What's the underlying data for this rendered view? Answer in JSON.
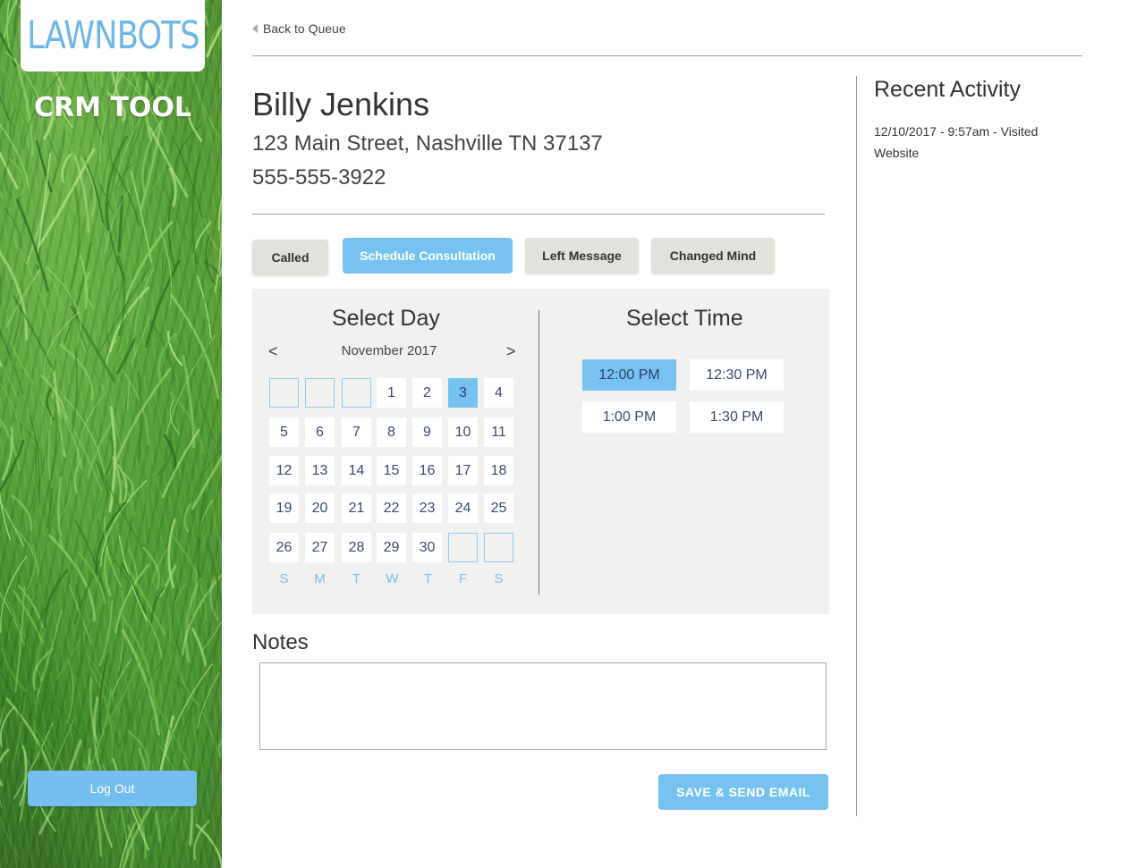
{
  "sidebar": {
    "logo": "LAWNBOTS",
    "subtitle": "CRM TOOL",
    "logout_label": "Log Out"
  },
  "nav": {
    "back_label": "Back to Queue"
  },
  "customer": {
    "name": "Billy Jenkins",
    "address": "123 Main Street, Nashville TN 37137",
    "phone": "555-555-3922"
  },
  "actions": [
    {
      "label": "Called",
      "active": false
    },
    {
      "label": "Schedule Consultation",
      "active": true
    },
    {
      "label": "Left Message",
      "active": false
    },
    {
      "label": "Changed Mind",
      "active": false
    }
  ],
  "calendar": {
    "title": "Select Day",
    "month_label": "November 2017",
    "prev_glyph": "<",
    "next_glyph": ">",
    "days": [
      "",
      "",
      "",
      "1",
      "2",
      "3",
      "4",
      "5",
      "6",
      "7",
      "8",
      "9",
      "10",
      "11",
      "12",
      "13",
      "14",
      "15",
      "16",
      "17",
      "18",
      "19",
      "20",
      "21",
      "22",
      "23",
      "24",
      "25",
      "26",
      "27",
      "28",
      "29",
      "30",
      "",
      ""
    ],
    "selected_day": "3",
    "weekdays": [
      "S",
      "M",
      "T",
      "W",
      "T",
      "F",
      "S"
    ]
  },
  "time": {
    "title": "Select Time",
    "slots": [
      "12:00 PM",
      "12:30 PM",
      "1:00 PM",
      "1:30 PM"
    ],
    "selected": "12:00 PM"
  },
  "notes": {
    "label": "Notes",
    "value": ""
  },
  "save_label": "SAVE & SEND EMAIL",
  "recent": {
    "title": "Recent Activity",
    "items": [
      "12/10/2017 - 9:57am - Visited Website"
    ]
  },
  "colors": {
    "accent": "#78c2f2",
    "logo": "#6cb7ea",
    "button_gray": "#e2e1dc",
    "panel": "#f1f1ef"
  }
}
